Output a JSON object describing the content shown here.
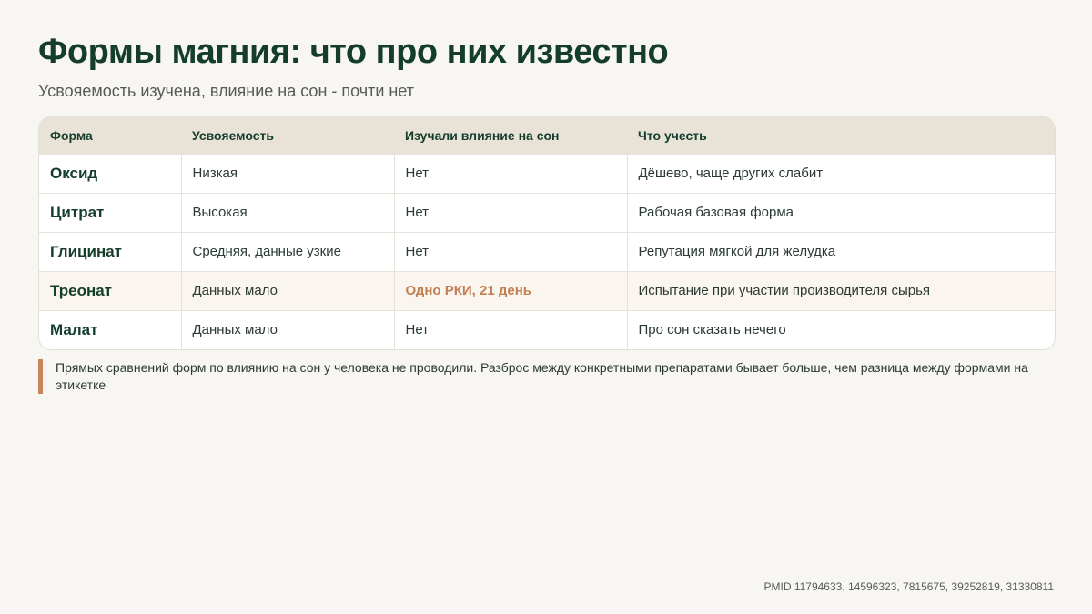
{
  "title": "Формы магния: что про них известно",
  "subtitle": "Усвояемость изучена, влияние на сон - почти нет",
  "table": {
    "headers": [
      "Форма",
      "Усвояемость",
      "Изучали влияние на сон",
      "Что учесть"
    ],
    "rows": [
      {
        "form": "Оксид",
        "absorption": "Низкая",
        "sleep_studied": "Нет",
        "notes": "Дёшево, чаще других слабит"
      },
      {
        "form": "Цитрат",
        "absorption": "Высокая",
        "sleep_studied": "Нет",
        "notes": "Рабочая базовая форма"
      },
      {
        "form": "Глицинат",
        "absorption": "Средняя, данные узкие",
        "sleep_studied": "Нет",
        "notes": "Репутация мягкой для желудка"
      },
      {
        "form": "Треонат",
        "absorption": "Данных мало",
        "sleep_studied": "Одно РКИ, 21 день",
        "notes": "Испытание при участии производителя сырья"
      },
      {
        "form": "Малат",
        "absorption": "Данных мало",
        "sleep_studied": "Нет",
        "notes": "Про сон сказать нечего"
      }
    ]
  },
  "note": "Прямых сравнений форм по влиянию на сон у человека не проводили. Разброс между конкретными препаратами бывает больше, чем разница между формами на этикетке",
  "footer": "PMID 11794633, 14596323, 7815675, 39252819, 31330811",
  "colors": {
    "title": "#143d2c",
    "header_bg": "#e8e3d6",
    "accent": "#c27f52",
    "highlight_row": "#faf5ee",
    "background": "#f7f6f3"
  }
}
